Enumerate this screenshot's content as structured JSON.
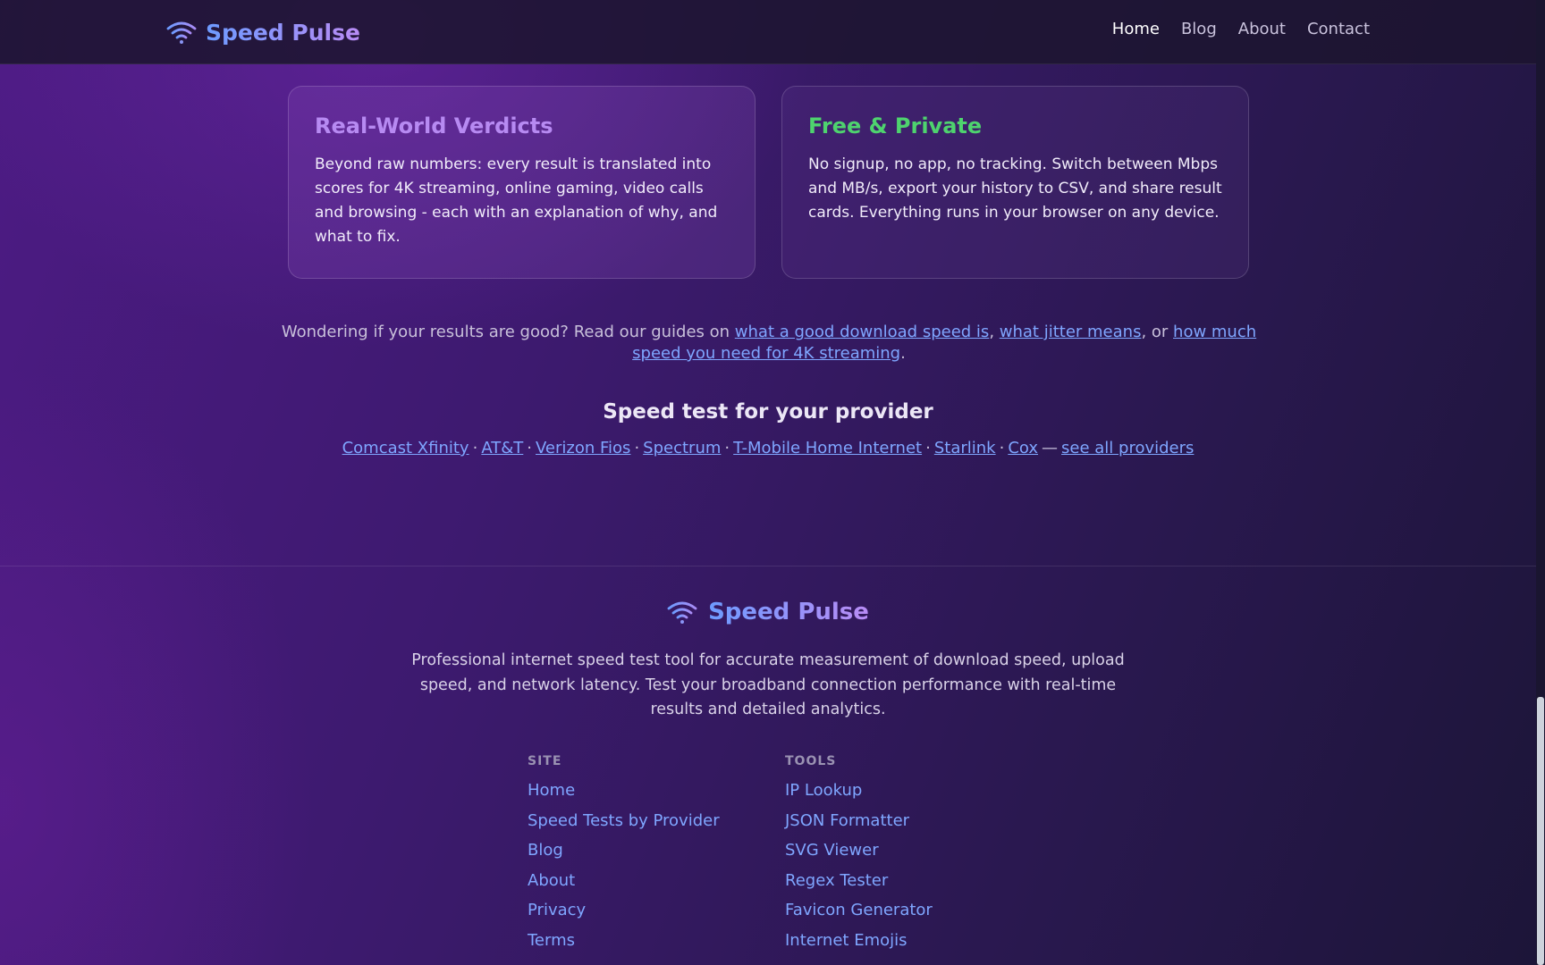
{
  "header": {
    "brand": "Speed Pulse",
    "brand_icon": "wifi-icon",
    "nav": [
      "Home",
      "Blog",
      "About",
      "Contact"
    ],
    "active_nav": "Home"
  },
  "cards": [
    {
      "title": "Real-World Verdicts",
      "text": "Beyond raw numbers: every result is translated into scores for 4K streaming, online gaming, video calls and browsing - each with an explanation of why, and what to fix."
    },
    {
      "title": "Free & Private",
      "text": "No signup, no app, no tracking. Switch between Mbps and MB/s, export your history to CSV, and share result cards. Everything runs in your browser on any device."
    }
  ],
  "guides": {
    "prefix": "Wondering if your results are good? Read our guides on ",
    "link1": "what a good download speed is",
    "sep1": ", ",
    "link2": "what jitter means",
    "sep2": ", or ",
    "link3": "how much speed you need for 4K streaming",
    "suffix": "."
  },
  "providers": {
    "title": "Speed test for your provider",
    "items": [
      "Comcast Xfinity",
      "AT&T",
      "Verizon Fios",
      "Spectrum",
      "T-Mobile Home Internet",
      "Starlink",
      "Cox"
    ],
    "dot": "·",
    "dash": "—",
    "all_link": "see all providers"
  },
  "footer": {
    "brand": "Speed Pulse",
    "description": "Professional internet speed test tool for accurate measurement of download speed, upload speed, and network latency. Test your broadband connection performance with real-time results and detailed analytics.",
    "site_heading": "SITE",
    "site_links": [
      "Home",
      "Speed Tests by Provider",
      "Blog",
      "About",
      "Privacy",
      "Terms"
    ],
    "tools_heading": "TOOLS",
    "tools_links": [
      "IP Lookup",
      "JSON Formatter",
      "SVG Viewer",
      "Regex Tester",
      "Favicon Generator",
      "Internet Emojis"
    ]
  },
  "colors": {
    "link": "#7fa6ff",
    "card1_title": "#b78af2",
    "card2_title": "#4ed36e"
  }
}
